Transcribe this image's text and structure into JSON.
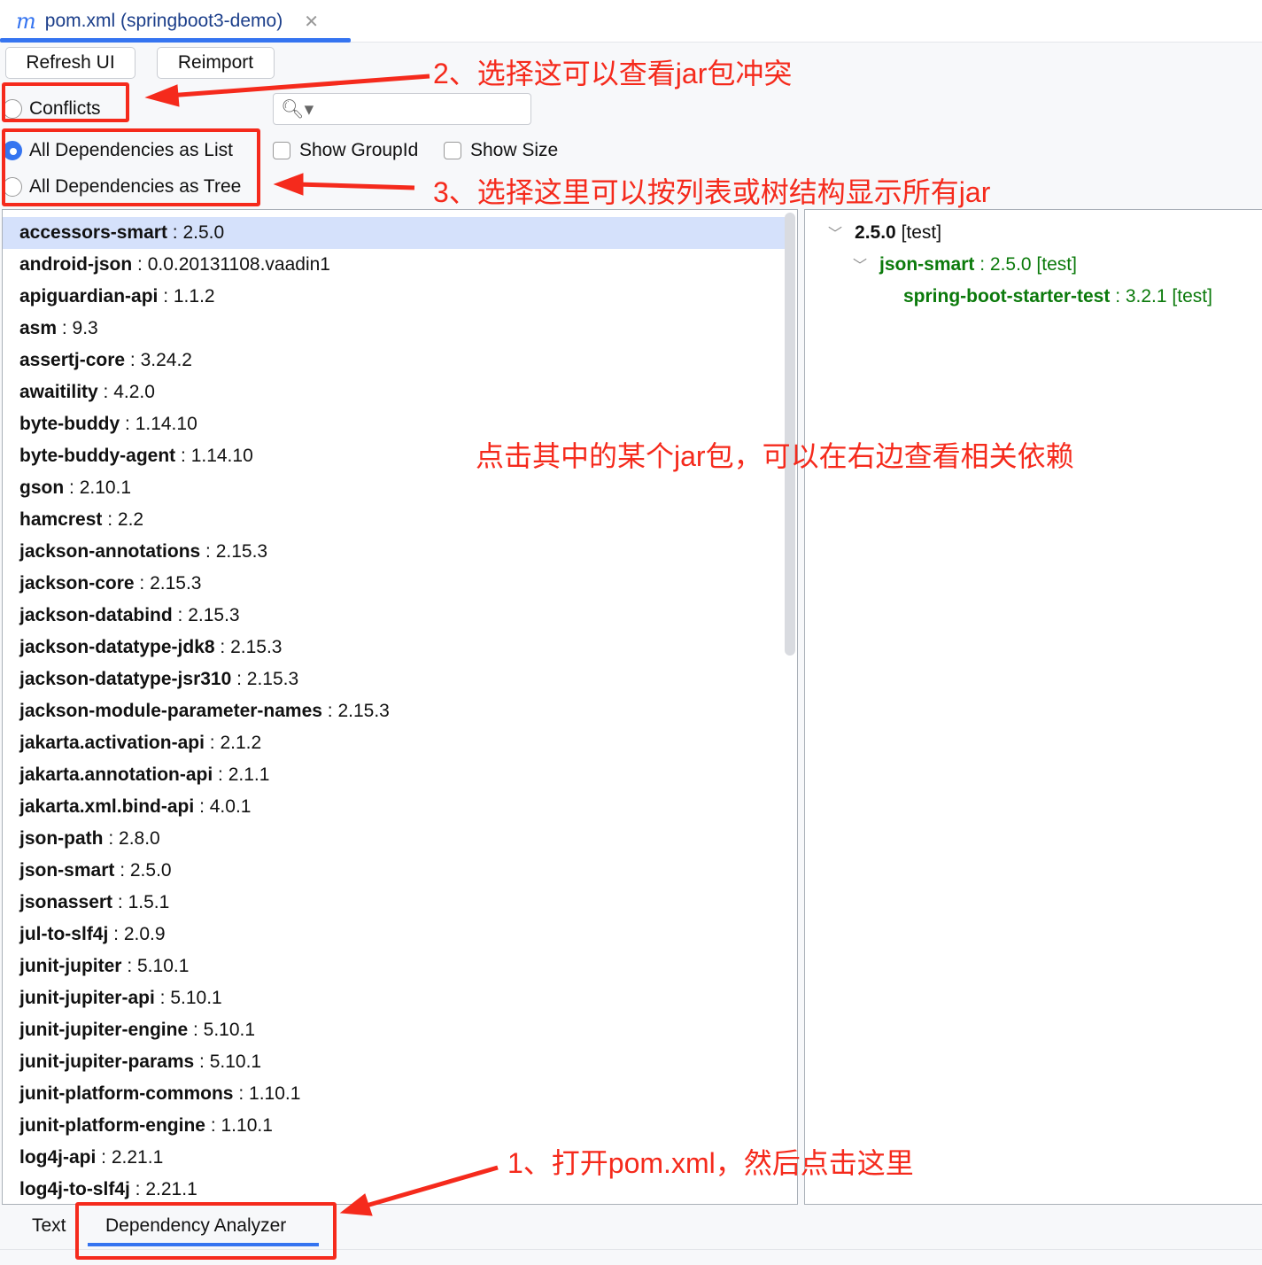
{
  "editor_tab": {
    "icon": "maven-m-icon",
    "title": "pom.xml (springboot3-demo)"
  },
  "toolbar": {
    "refresh": "Refresh UI",
    "reimport": "Reimport"
  },
  "options": {
    "conflicts": "Conflicts",
    "as_list": "All Dependencies as List",
    "as_tree": "All Dependencies as Tree",
    "show_groupid": "Show GroupId",
    "show_size": "Show Size",
    "selected": "All Dependencies as List"
  },
  "search": {
    "value": "",
    "placeholder": ""
  },
  "dependencies": [
    {
      "name": "accessors-smart",
      "version": "2.5.0"
    },
    {
      "name": "android-json",
      "version": "0.0.20131108.vaadin1"
    },
    {
      "name": "apiguardian-api",
      "version": "1.1.2"
    },
    {
      "name": "asm",
      "version": "9.3"
    },
    {
      "name": "assertj-core",
      "version": "3.24.2"
    },
    {
      "name": "awaitility",
      "version": "4.2.0"
    },
    {
      "name": "byte-buddy",
      "version": "1.14.10"
    },
    {
      "name": "byte-buddy-agent",
      "version": "1.14.10"
    },
    {
      "name": "gson",
      "version": "2.10.1"
    },
    {
      "name": "hamcrest",
      "version": "2.2"
    },
    {
      "name": "jackson-annotations",
      "version": "2.15.3"
    },
    {
      "name": "jackson-core",
      "version": "2.15.3"
    },
    {
      "name": "jackson-databind",
      "version": "2.15.3"
    },
    {
      "name": "jackson-datatype-jdk8",
      "version": "2.15.3"
    },
    {
      "name": "jackson-datatype-jsr310",
      "version": "2.15.3"
    },
    {
      "name": "jackson-module-parameter-names",
      "version": "2.15.3"
    },
    {
      "name": "jakarta.activation-api",
      "version": "2.1.2"
    },
    {
      "name": "jakarta.annotation-api",
      "version": "2.1.1"
    },
    {
      "name": "jakarta.xml.bind-api",
      "version": "4.0.1"
    },
    {
      "name": "json-path",
      "version": "2.8.0"
    },
    {
      "name": "json-smart",
      "version": "2.5.0"
    },
    {
      "name": "jsonassert",
      "version": "1.5.1"
    },
    {
      "name": "jul-to-slf4j",
      "version": "2.0.9"
    },
    {
      "name": "junit-jupiter",
      "version": "5.10.1"
    },
    {
      "name": "junit-jupiter-api",
      "version": "5.10.1"
    },
    {
      "name": "junit-jupiter-engine",
      "version": "5.10.1"
    },
    {
      "name": "junit-jupiter-params",
      "version": "5.10.1"
    },
    {
      "name": "junit-platform-commons",
      "version": "1.10.1"
    },
    {
      "name": "junit-platform-engine",
      "version": "1.10.1"
    },
    {
      "name": "log4j-api",
      "version": "2.21.1"
    },
    {
      "name": "log4j-to-slf4j",
      "version": "2.21.1"
    }
  ],
  "detail_tree": {
    "root": {
      "version": "2.5.0",
      "scope": "[test]"
    },
    "child": {
      "name": "json-smart",
      "version": ": 2.5.0 [test]"
    },
    "grandchild": {
      "name": "spring-boot-starter-test",
      "version": ": 3.2.1 [test]"
    }
  },
  "bottom_tabs": {
    "text": "Text",
    "analyzer": "Dependency Analyzer",
    "active": "Dependency Analyzer"
  },
  "annotations": {
    "step1": "1、打开pom.xml，然后点击这里",
    "step2": "2、选择这可以查看jar包冲突",
    "step3": "3、选择这里可以按列表或树结构显示所有jar",
    "middle": "点击其中的某个jar包，可以在右边查看相关依赖"
  },
  "colors": {
    "accent": "#3574f0",
    "annotation": "#f52a1c",
    "tree_green": "#0b7a0b",
    "selection": "#d5e1fb"
  }
}
